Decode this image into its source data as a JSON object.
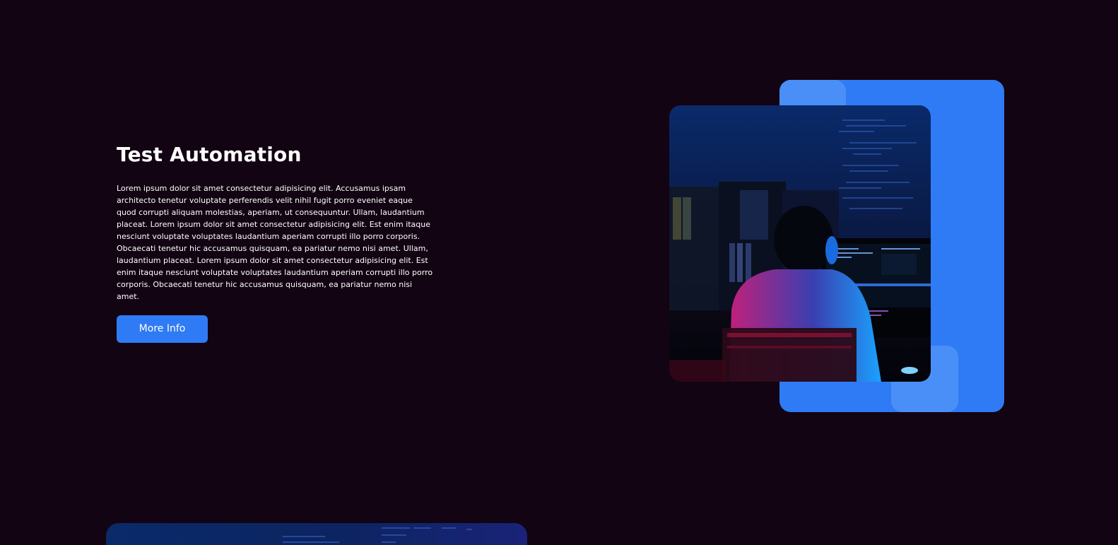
{
  "section": {
    "title": "Test Automation",
    "body": "Lorem ipsum dolor sit amet consectetur adipisicing elit. Accusamus ipsam architecto tenetur voluptate perferendis velit nihil fugit porro eveniet eaque quod corrupti aliquam molestias, aperiam, ut consequuntur. Ullam, laudantium placeat. Lorem ipsum dolor sit amet consectetur adipisicing elit. Est enim itaque nesciunt voluptate voluptates laudantium aperiam corrupti illo porro corporis. Obcaecati tenetur hic accusamus quisquam, ea pariatur nemo nisi amet. Ullam, laudantium placeat. Lorem ipsum dolor sit amet consectetur adipisicing elit. Est enim itaque nesciunt voluptate voluptates laudantium aperiam corrupti illo porro corporis. Obcaecati tenetur hic accusamus quisquam, ea pariatur nemo nisi amet.",
    "button_label": "More Info"
  },
  "colors": {
    "background": "#120412",
    "accent": "#2f7bf5",
    "accent_light": "#4a8ff8",
    "text": "#ffffff"
  }
}
